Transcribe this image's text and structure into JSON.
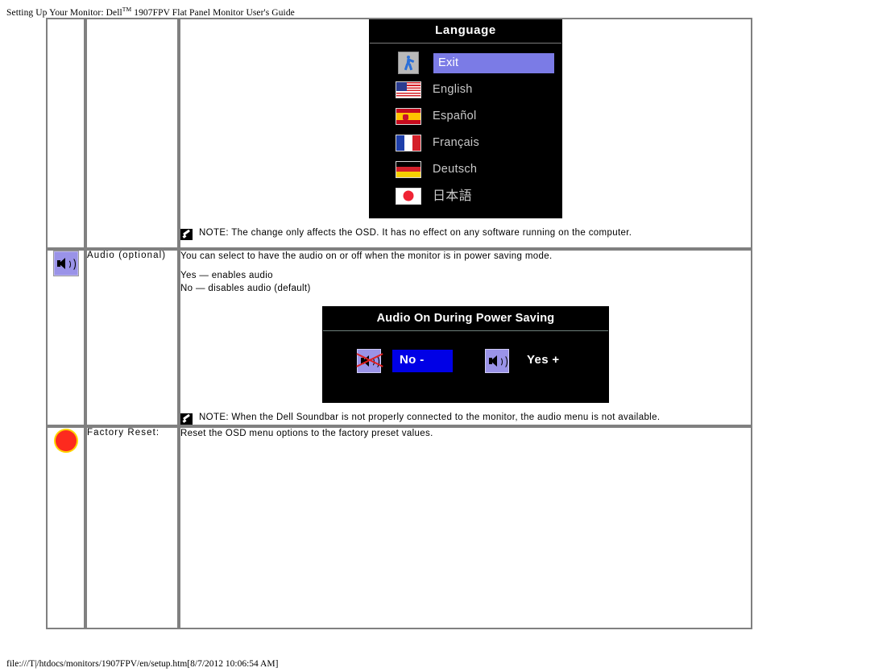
{
  "page": {
    "header_title": "Setting Up Your Monitor: Dell™ 1907FPV Flat Panel Monitor User's Guide",
    "header_prefix": "Setting Up Your Monitor: Dell",
    "header_tm": "TM",
    "header_suffix": " 1907FPV Flat Panel Monitor User's Guide",
    "footer": "file:///T|/htdocs/monitors/1907FPV/en/setup.htm[8/7/2012 10:06:54 AM]"
  },
  "colors": {
    "osd_background": "#000000",
    "osd_title_text": "#ffffff",
    "osd_item_text": "#c9c9c9",
    "lang_highlight": "#7b7be6",
    "audio_highlight": "#0000e6",
    "reset_red": "#fd2a1e",
    "reset_ring_yellow": "#ffd400",
    "audio_icon_purple": "#9a93e8",
    "table_border": "#808080"
  },
  "rows": [
    {
      "id": "language",
      "icon": "",
      "label": "",
      "osd": {
        "title": "Language",
        "items": [
          {
            "label": "Exit",
            "icon": "exit-sign-icon",
            "selected": true
          },
          {
            "label": "English",
            "icon": "flag-usa-icon",
            "selected": false
          },
          {
            "label": "Español",
            "icon": "flag-spain-icon",
            "selected": false
          },
          {
            "label": "Français",
            "icon": "flag-france-icon",
            "selected": false
          },
          {
            "label": "Deutsch",
            "icon": "flag-germany-icon",
            "selected": false
          },
          {
            "label": "日本語",
            "icon": "flag-japan-icon",
            "selected": false
          }
        ]
      },
      "note": "NOTE: The change only affects the OSD. It has no effect on any software running on the computer."
    },
    {
      "id": "audio",
      "icon": "speaker-icon",
      "label": "Audio (optional)",
      "desc_main": "You can select to have the audio on or off when the monitor is in power saving mode.",
      "desc_yes": "Yes — enables audio",
      "desc_no": "No — disables audio (default)",
      "osd": {
        "title": "Audio On During Power Saving",
        "option_no": "No -",
        "option_yes": "Yes +",
        "no_selected": true,
        "icon_no": "speaker-muted-icon",
        "icon_yes": "speaker-icon"
      },
      "note": "NOTE: When the Dell Soundbar is not properly connected to the monitor, the audio menu is not available."
    },
    {
      "id": "factory-reset",
      "icon": "red-circle-icon",
      "label": "Factory Reset:",
      "desc_main": "Reset the OSD menu options to  the factory preset values."
    }
  ]
}
